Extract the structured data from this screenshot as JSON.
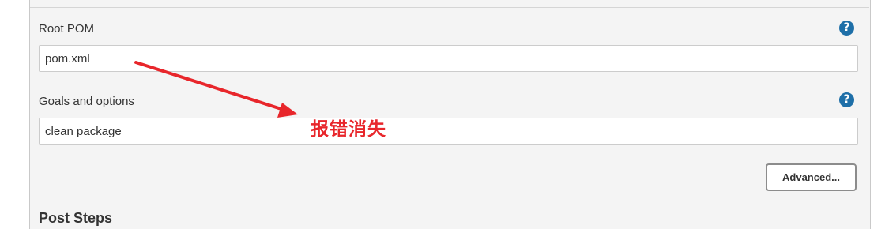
{
  "root_pom": {
    "label": "Root POM",
    "value": "pom.xml",
    "help_icon": "question-circle-icon"
  },
  "goals": {
    "label": "Goals and options",
    "value": "clean package",
    "help_icon": "question-circle-icon"
  },
  "advanced_button_label": "Advanced...",
  "next_section_heading": "Post Steps",
  "annotation": {
    "text": "报错消失",
    "color": "#e8262b"
  },
  "colors": {
    "help_icon": "#1e6fa8",
    "panel_background": "#f4f4f4"
  }
}
